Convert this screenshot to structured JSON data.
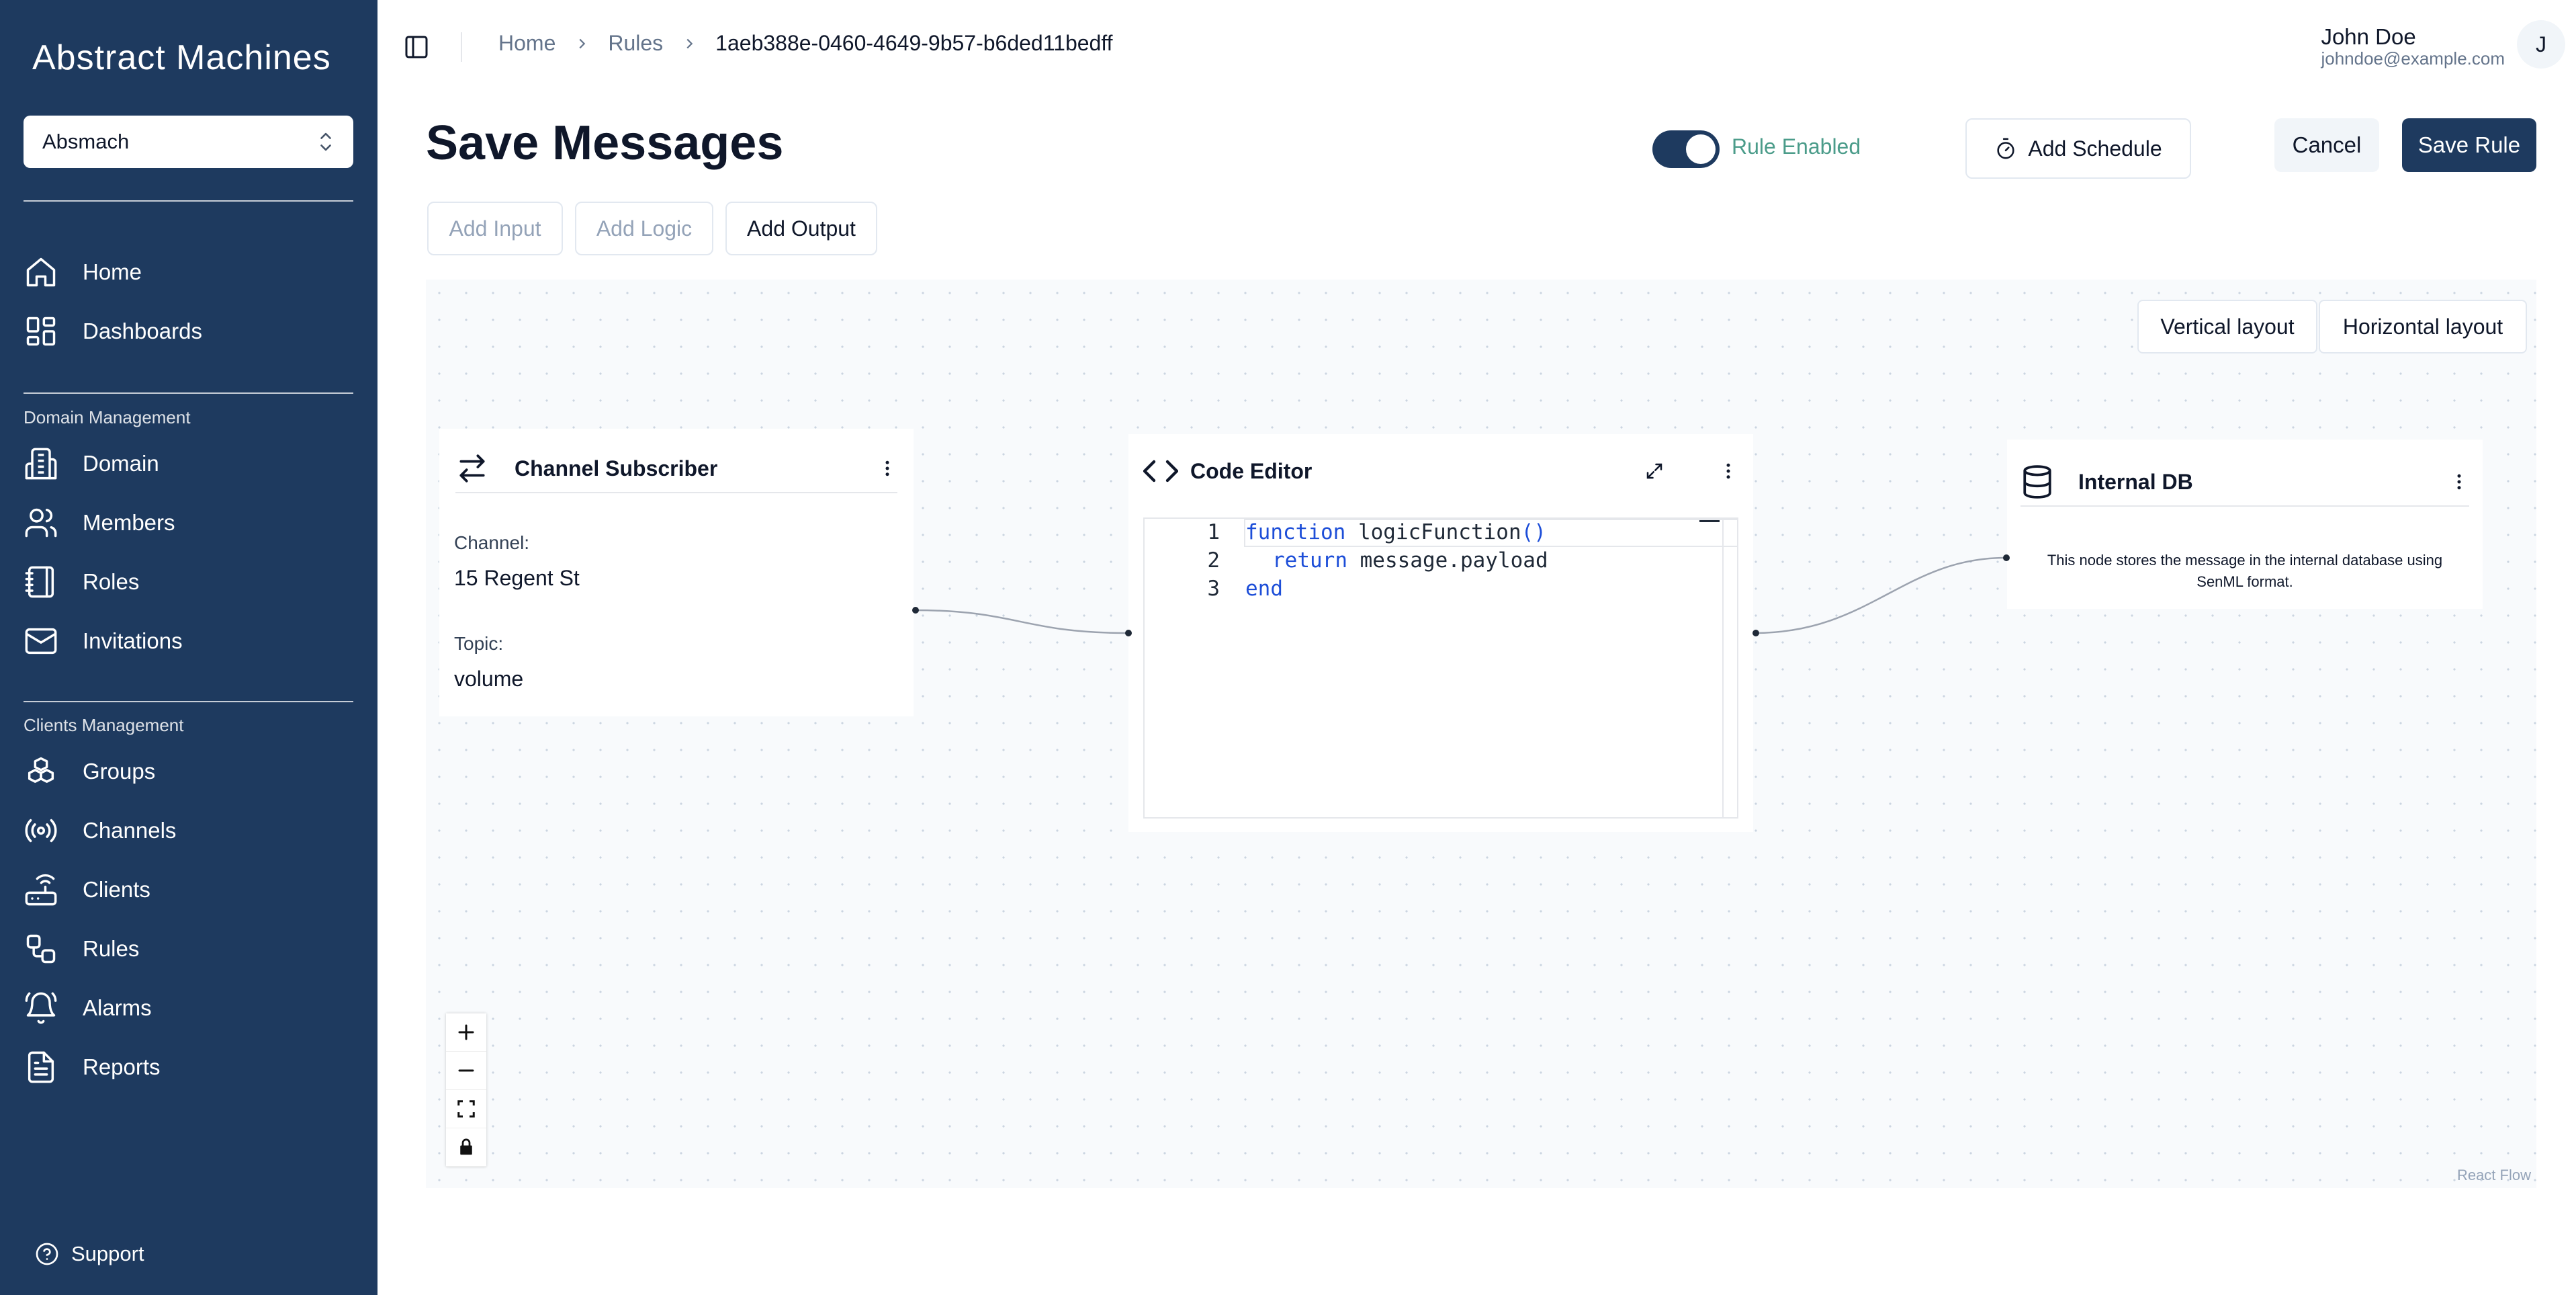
{
  "app": {
    "logo_text": "Abstract Machines"
  },
  "sidebar": {
    "org_selector": {
      "value": "Absmach"
    },
    "top_items": [
      {
        "label": "Home",
        "icon": "house-icon"
      },
      {
        "label": "Dashboards",
        "icon": "dashboard-grid-icon"
      }
    ],
    "domain_section": {
      "title": "Domain Management",
      "items": [
        {
          "label": "Domain",
          "icon": "building-icon"
        },
        {
          "label": "Members",
          "icon": "users-icon"
        },
        {
          "label": "Roles",
          "icon": "notebook-icon"
        },
        {
          "label": "Invitations",
          "icon": "mail-icon"
        }
      ]
    },
    "clients_section": {
      "title": "Clients Management",
      "items": [
        {
          "label": "Groups",
          "icon": "boxes-icon"
        },
        {
          "label": "Channels",
          "icon": "radio-icon"
        },
        {
          "label": "Clients",
          "icon": "router-icon"
        },
        {
          "label": "Rules",
          "icon": "workflow-icon"
        },
        {
          "label": "Alarms",
          "icon": "bell-ring-icon"
        },
        {
          "label": "Reports",
          "icon": "file-text-icon"
        }
      ]
    },
    "support_label": "Support"
  },
  "header": {
    "breadcrumb": [
      "Home",
      "Rules",
      "1aeb388e-0460-4649-9b57-b6ded11bedff"
    ],
    "user": {
      "name": "John Doe",
      "email": "johndoe@example.com",
      "avatar_initial": "J"
    }
  },
  "page": {
    "title": "Save Messages",
    "toggle_label": "Rule Enabled",
    "toggle_on": true,
    "add_schedule_label": "Add Schedule",
    "cancel_label": "Cancel",
    "save_label": "Save Rule",
    "add_input_label": "Add Input",
    "add_logic_label": "Add Logic",
    "add_output_label": "Add Output"
  },
  "canvas": {
    "vertical_layout_label": "Vertical layout",
    "horizontal_layout_label": "Horizontal layout",
    "attribution": "React Flow",
    "nodes": {
      "subscriber": {
        "title": "Channel Subscriber",
        "channel_label": "Channel:",
        "channel_value": "15 Regent St",
        "topic_label": "Topic:",
        "topic_value": "volume"
      },
      "code_editor": {
        "title": "Code Editor",
        "line_numbers": [
          "1",
          "2",
          "3"
        ],
        "lines": {
          "l1_kw": "function",
          "l1_rest": " logicFunction",
          "l1_paren": "()",
          "l2_kw": "return",
          "l2_rest": " message.payload",
          "l3_kw": "end"
        }
      },
      "internal_db": {
        "title": "Internal DB",
        "description": "This node stores the message in the internal database using SenML format."
      }
    }
  },
  "colors": {
    "sidebar_bg": "#1e3a5f",
    "primary": "#1e3a5f",
    "toggle_label": "#4b9c8a",
    "keyword": "#1d4ed8"
  }
}
